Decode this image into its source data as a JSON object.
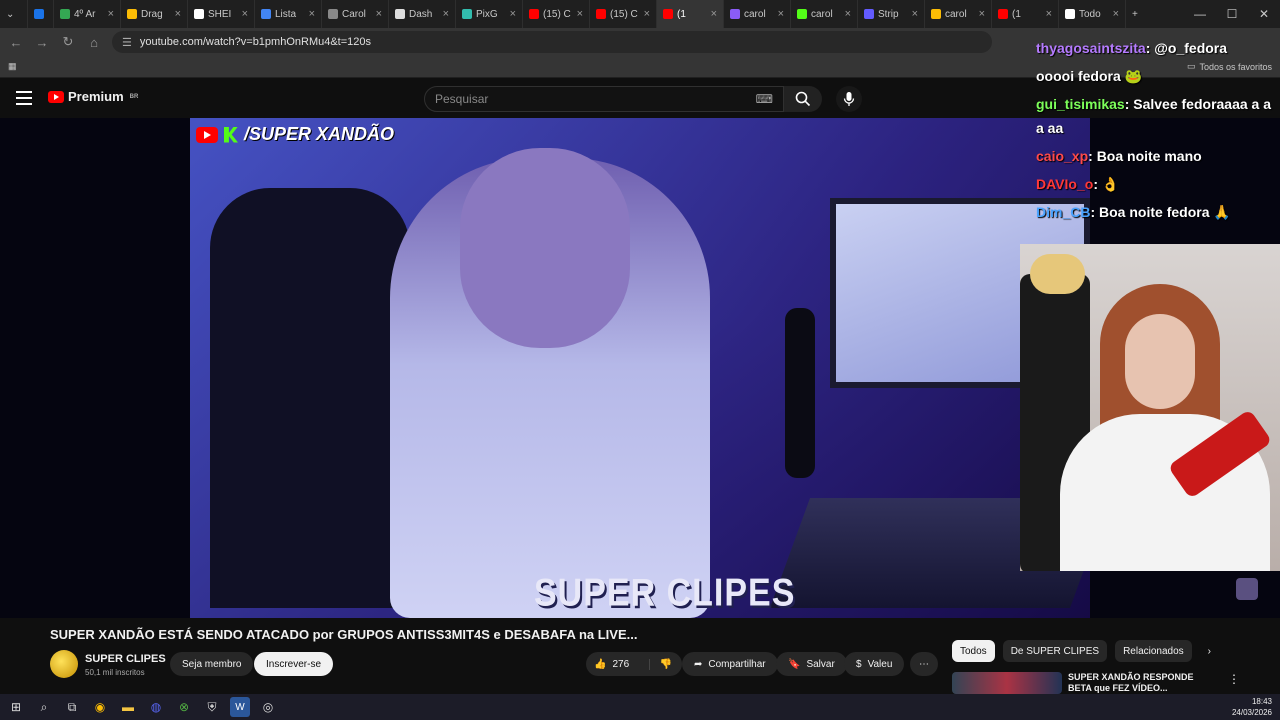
{
  "browser": {
    "tabs": [
      {
        "label": "",
        "color": "#1a73e8"
      },
      {
        "label": "4º Ar",
        "color": "#34a853"
      },
      {
        "label": "Drag",
        "color": "#fbbc05"
      },
      {
        "label": "SHEI",
        "color": "#ffffff"
      },
      {
        "label": "Lista",
        "color": "#4285f4"
      },
      {
        "label": "Carol",
        "color": "#888888"
      },
      {
        "label": "Dash",
        "color": "#dddddd"
      },
      {
        "label": "PixG",
        "color": "#32bcad"
      },
      {
        "label": "(15) C",
        "color": "#ff0000"
      },
      {
        "label": "(15) C",
        "color": "#ff0000"
      },
      {
        "label": "(1",
        "color": "#ff0000"
      },
      {
        "label": "carol",
        "color": "#8a5cf6"
      },
      {
        "label": "carol",
        "color": "#53fc18"
      },
      {
        "label": "Strip",
        "color": "#635bff"
      },
      {
        "label": "carol",
        "color": "#fbbc05"
      },
      {
        "label": "(1",
        "color": "#ff0000"
      },
      {
        "label": "Todo",
        "color": "#ffffff"
      }
    ],
    "new_tab": "+",
    "url": "youtube.com/watch?v=b1pmhOnRMu4&t=120s",
    "bookmarks_right": "Todos os favoritos"
  },
  "youtube": {
    "logo_text": "Premium",
    "logo_region": "BR",
    "search_placeholder": "Pesquisar"
  },
  "video": {
    "channel_tag": "/SUPER XANDÃO",
    "watermark": "SUPER CLIPES",
    "title": "SUPER XANDÃO ESTÁ SENDO ATACADO por GRUPOS ANTISS3MIT4S e DESABAFA na LIVE...",
    "channel_name": "SUPER CLIPES",
    "subscribers": "50,1 mil inscritos",
    "join_label": "Seja membro",
    "subscribe_label": "Inscrever-se",
    "likes": "276",
    "share_label": "Compartilhar",
    "save_label": "Salvar",
    "thanks_label": "Valeu",
    "more_label": "⋯"
  },
  "chat": [
    {
      "user": "thyagosaintszita",
      "text": ": @o_fedora",
      "color": "#b57bff"
    },
    {
      "user": "",
      "text": "ooooi fedora 🐸",
      "color": "#ffffff"
    },
    {
      "user": "gui_tisimikas",
      "text": ": Salvee fedoraaaa a a a aa",
      "color": "#7dff5a"
    },
    {
      "user": "caio_xp",
      "text": ": Boa noite mano",
      "color": "#ff4a4a"
    },
    {
      "user": "DAVIo_o",
      "text": ": 👌",
      "color": "#ff3838"
    },
    {
      "user": "Dim_CB",
      "text": ": Boa noite fedora 🙏",
      "color": "#4aa3ff"
    }
  ],
  "chips": [
    "Todos",
    "De SUPER CLIPES",
    "Relacionados"
  ],
  "recommended": {
    "title": "SUPER XANDÃO RESPONDE BETA que FEZ VÍDEO..."
  },
  "taskbar": {
    "time": "18:43",
    "date": "24/03/2026"
  }
}
